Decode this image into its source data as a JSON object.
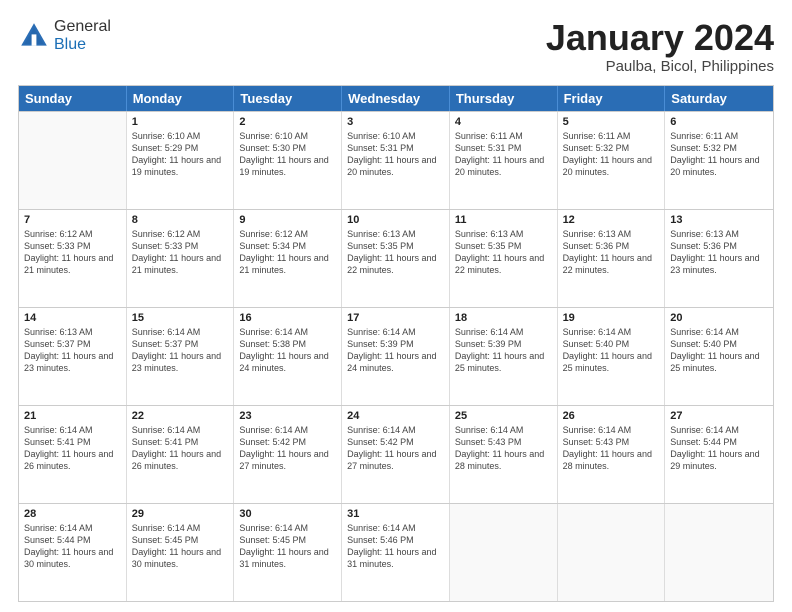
{
  "header": {
    "logo_general": "General",
    "logo_blue": "Blue",
    "month_title": "January 2024",
    "location": "Paulba, Bicol, Philippines"
  },
  "days_of_week": [
    "Sunday",
    "Monday",
    "Tuesday",
    "Wednesday",
    "Thursday",
    "Friday",
    "Saturday"
  ],
  "weeks": [
    [
      {
        "day": "",
        "empty": true
      },
      {
        "day": "1",
        "sunrise": "6:10 AM",
        "sunset": "5:29 PM",
        "daylight": "11 hours and 19 minutes."
      },
      {
        "day": "2",
        "sunrise": "6:10 AM",
        "sunset": "5:30 PM",
        "daylight": "11 hours and 19 minutes."
      },
      {
        "day": "3",
        "sunrise": "6:10 AM",
        "sunset": "5:31 PM",
        "daylight": "11 hours and 20 minutes."
      },
      {
        "day": "4",
        "sunrise": "6:11 AM",
        "sunset": "5:31 PM",
        "daylight": "11 hours and 20 minutes."
      },
      {
        "day": "5",
        "sunrise": "6:11 AM",
        "sunset": "5:32 PM",
        "daylight": "11 hours and 20 minutes."
      },
      {
        "day": "6",
        "sunrise": "6:11 AM",
        "sunset": "5:32 PM",
        "daylight": "11 hours and 20 minutes."
      }
    ],
    [
      {
        "day": "7",
        "sunrise": "6:12 AM",
        "sunset": "5:33 PM",
        "daylight": "11 hours and 21 minutes."
      },
      {
        "day": "8",
        "sunrise": "6:12 AM",
        "sunset": "5:33 PM",
        "daylight": "11 hours and 21 minutes."
      },
      {
        "day": "9",
        "sunrise": "6:12 AM",
        "sunset": "5:34 PM",
        "daylight": "11 hours and 21 minutes."
      },
      {
        "day": "10",
        "sunrise": "6:13 AM",
        "sunset": "5:35 PM",
        "daylight": "11 hours and 22 minutes."
      },
      {
        "day": "11",
        "sunrise": "6:13 AM",
        "sunset": "5:35 PM",
        "daylight": "11 hours and 22 minutes."
      },
      {
        "day": "12",
        "sunrise": "6:13 AM",
        "sunset": "5:36 PM",
        "daylight": "11 hours and 22 minutes."
      },
      {
        "day": "13",
        "sunrise": "6:13 AM",
        "sunset": "5:36 PM",
        "daylight": "11 hours and 23 minutes."
      }
    ],
    [
      {
        "day": "14",
        "sunrise": "6:13 AM",
        "sunset": "5:37 PM",
        "daylight": "11 hours and 23 minutes."
      },
      {
        "day": "15",
        "sunrise": "6:14 AM",
        "sunset": "5:37 PM",
        "daylight": "11 hours and 23 minutes."
      },
      {
        "day": "16",
        "sunrise": "6:14 AM",
        "sunset": "5:38 PM",
        "daylight": "11 hours and 24 minutes."
      },
      {
        "day": "17",
        "sunrise": "6:14 AM",
        "sunset": "5:39 PM",
        "daylight": "11 hours and 24 minutes."
      },
      {
        "day": "18",
        "sunrise": "6:14 AM",
        "sunset": "5:39 PM",
        "daylight": "11 hours and 25 minutes."
      },
      {
        "day": "19",
        "sunrise": "6:14 AM",
        "sunset": "5:40 PM",
        "daylight": "11 hours and 25 minutes."
      },
      {
        "day": "20",
        "sunrise": "6:14 AM",
        "sunset": "5:40 PM",
        "daylight": "11 hours and 25 minutes."
      }
    ],
    [
      {
        "day": "21",
        "sunrise": "6:14 AM",
        "sunset": "5:41 PM",
        "daylight": "11 hours and 26 minutes."
      },
      {
        "day": "22",
        "sunrise": "6:14 AM",
        "sunset": "5:41 PM",
        "daylight": "11 hours and 26 minutes."
      },
      {
        "day": "23",
        "sunrise": "6:14 AM",
        "sunset": "5:42 PM",
        "daylight": "11 hours and 27 minutes."
      },
      {
        "day": "24",
        "sunrise": "6:14 AM",
        "sunset": "5:42 PM",
        "daylight": "11 hours and 27 minutes."
      },
      {
        "day": "25",
        "sunrise": "6:14 AM",
        "sunset": "5:43 PM",
        "daylight": "11 hours and 28 minutes."
      },
      {
        "day": "26",
        "sunrise": "6:14 AM",
        "sunset": "5:43 PM",
        "daylight": "11 hours and 28 minutes."
      },
      {
        "day": "27",
        "sunrise": "6:14 AM",
        "sunset": "5:44 PM",
        "daylight": "11 hours and 29 minutes."
      }
    ],
    [
      {
        "day": "28",
        "sunrise": "6:14 AM",
        "sunset": "5:44 PM",
        "daylight": "11 hours and 30 minutes."
      },
      {
        "day": "29",
        "sunrise": "6:14 AM",
        "sunset": "5:45 PM",
        "daylight": "11 hours and 30 minutes."
      },
      {
        "day": "30",
        "sunrise": "6:14 AM",
        "sunset": "5:45 PM",
        "daylight": "11 hours and 31 minutes."
      },
      {
        "day": "31",
        "sunrise": "6:14 AM",
        "sunset": "5:46 PM",
        "daylight": "11 hours and 31 minutes."
      },
      {
        "day": "",
        "empty": true
      },
      {
        "day": "",
        "empty": true
      },
      {
        "day": "",
        "empty": true
      }
    ]
  ],
  "labels": {
    "sunrise_prefix": "Sunrise: ",
    "sunset_prefix": "Sunset: ",
    "daylight_prefix": "Daylight: "
  }
}
